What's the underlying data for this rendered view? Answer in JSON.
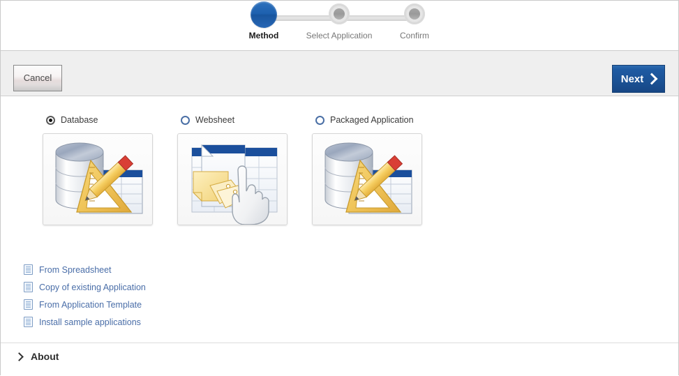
{
  "wizard": {
    "steps": [
      {
        "label": "Method",
        "state": "active"
      },
      {
        "label": "Select Application",
        "state": "inactive"
      },
      {
        "label": "Confirm",
        "state": "inactive"
      }
    ]
  },
  "toolbar": {
    "cancel_label": "Cancel",
    "next_label": "Next",
    "next_icon": "chevron-right-icon",
    "next_color": "#1b5296"
  },
  "main": {
    "methods": [
      {
        "label": "Database",
        "selected": true,
        "icon": "database-design-icon"
      },
      {
        "label": "Websheet",
        "selected": false,
        "icon": "websheet-hand-icon"
      },
      {
        "label": "Packaged Application",
        "selected": false,
        "icon": "database-design-icon"
      }
    ],
    "links": [
      {
        "label": "From Spreadsheet",
        "icon": "document-icon"
      },
      {
        "label": "Copy of existing Application",
        "icon": "document-icon"
      },
      {
        "label": "From Application Template",
        "icon": "document-icon"
      },
      {
        "label": "Install sample applications",
        "icon": "document-icon"
      }
    ],
    "link_color": "#4a6ea8"
  },
  "footer": {
    "about_label": "About",
    "about_icon": "chevron-right-icon"
  }
}
